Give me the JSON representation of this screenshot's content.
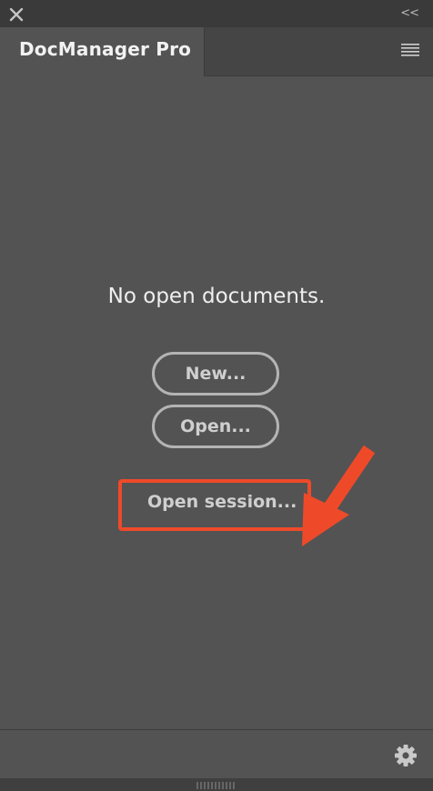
{
  "window": {
    "close_icon": "close-icon",
    "collapse_label": "<<"
  },
  "tab": {
    "title": "DocManager Pro",
    "menu_icon": "hamburger-menu-icon"
  },
  "main": {
    "empty_message": "No open documents.",
    "new_label": "New...",
    "open_label": "Open...",
    "session_label": "Open session..."
  },
  "annotation": {
    "color": "#ee4a2a"
  },
  "footer": {
    "settings_icon": "gear-icon"
  }
}
